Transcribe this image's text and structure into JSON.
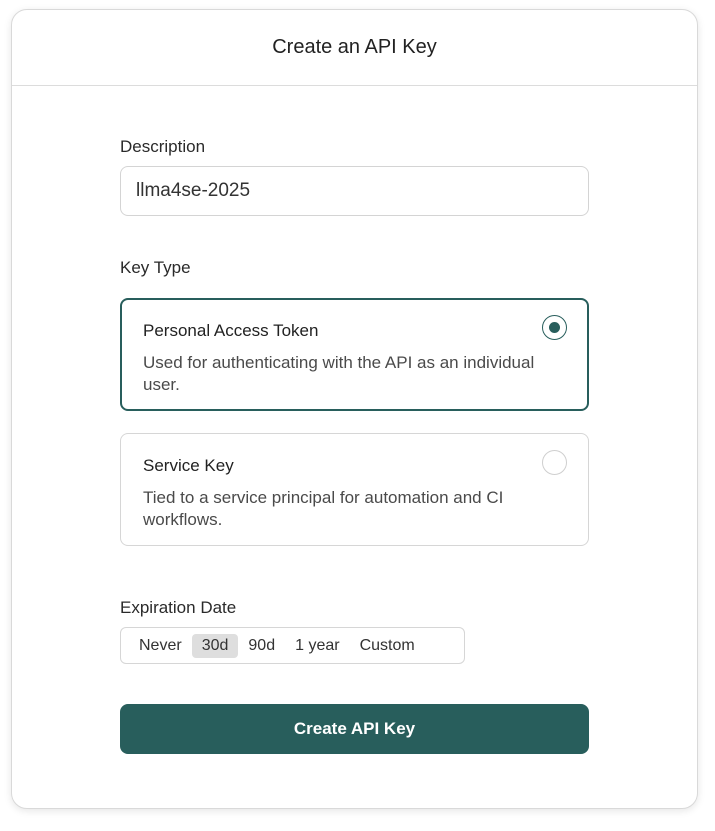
{
  "dialog": {
    "title": "Create an API Key"
  },
  "description": {
    "label": "Description",
    "value": "llma4se-2025"
  },
  "key_type": {
    "label": "Key Type",
    "options": [
      {
        "title": "Personal Access Token",
        "description": "Used for authenticating with the API as an individual user.",
        "selected": true
      },
      {
        "title": "Service Key",
        "description": "Tied to a service principal for automation and CI workflows.",
        "selected": false
      }
    ]
  },
  "expiration": {
    "label": "Expiration Date",
    "options": [
      "Never",
      "30d",
      "90d",
      "1 year",
      "Custom"
    ],
    "selected": "30d"
  },
  "submit": {
    "label": "Create API Key"
  },
  "colors": {
    "accent": "#285e5c"
  }
}
